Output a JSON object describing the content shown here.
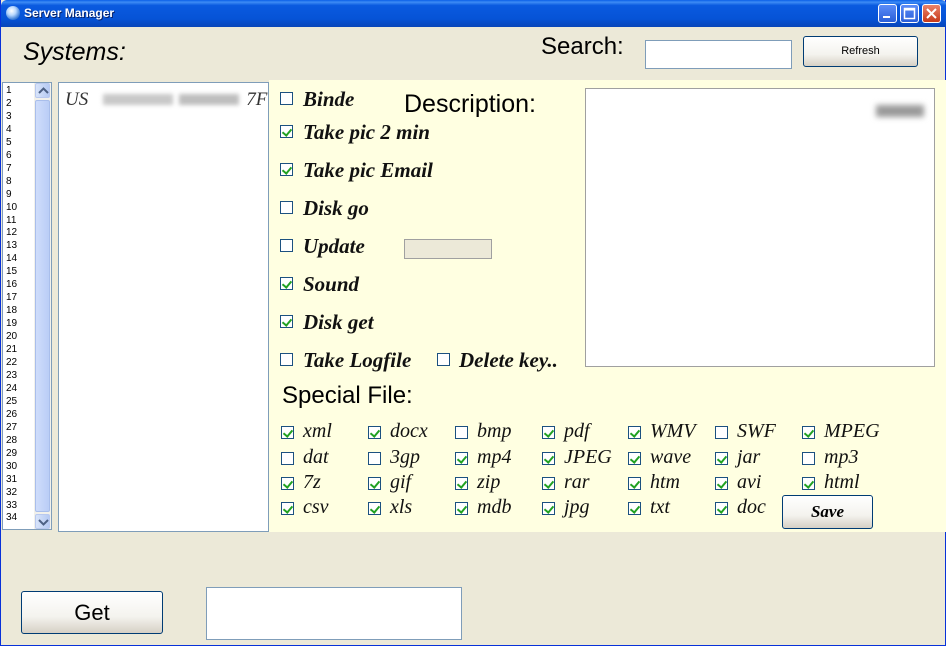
{
  "window": {
    "title": "Server Manager"
  },
  "header": {
    "systems_label": "Systems:",
    "search_label": "Search:",
    "search_value": "",
    "refresh_label": "Refresh"
  },
  "line_numbers": "1\n2\n3\n4\n5\n6\n7\n8\n9\n10\n11\n12\n13\n14\n15\n16\n17\n18\n19\n20\n21\n22\n23\n24\n25\n26\n27\n28\n29\n30\n31\n32\n33\n34",
  "systems": {
    "entry_prefix": "US",
    "entry_suffix": "7F"
  },
  "options": [
    {
      "label": "Binde",
      "checked": false
    },
    {
      "label": "Take pic 2 min",
      "checked": true
    },
    {
      "label": "Take pic Email",
      "checked": true
    },
    {
      "label": "Disk go",
      "checked": false
    },
    {
      "label": "Update",
      "checked": false
    },
    {
      "label": "Sound",
      "checked": true
    },
    {
      "label": "Disk get",
      "checked": true
    },
    {
      "label": "Take Logfile",
      "checked": false
    },
    {
      "label": "Delete key..",
      "checked": false
    }
  ],
  "description": {
    "label": "Description:"
  },
  "special_file": {
    "label": "Special File:",
    "files": [
      {
        "label": "xml",
        "checked": true
      },
      {
        "label": "docx",
        "checked": true
      },
      {
        "label": "bmp",
        "checked": false
      },
      {
        "label": "pdf",
        "checked": true
      },
      {
        "label": "WMV",
        "checked": true
      },
      {
        "label": "SWF",
        "checked": false
      },
      {
        "label": "MPEG",
        "checked": true
      },
      {
        "label": "dat",
        "checked": false
      },
      {
        "label": "3gp",
        "checked": false
      },
      {
        "label": "mp4",
        "checked": true
      },
      {
        "label": "JPEG",
        "checked": true
      },
      {
        "label": "wave",
        "checked": true
      },
      {
        "label": "jar",
        "checked": true
      },
      {
        "label": "mp3",
        "checked": false
      },
      {
        "label": "7z",
        "checked": true
      },
      {
        "label": "gif",
        "checked": true
      },
      {
        "label": "zip",
        "checked": true
      },
      {
        "label": "rar",
        "checked": true
      },
      {
        "label": "htm",
        "checked": true
      },
      {
        "label": "avi",
        "checked": true
      },
      {
        "label": "html",
        "checked": true
      },
      {
        "label": "csv",
        "checked": true
      },
      {
        "label": "xls",
        "checked": true
      },
      {
        "label": "mdb",
        "checked": true
      },
      {
        "label": "jpg",
        "checked": true
      },
      {
        "label": "txt",
        "checked": true
      },
      {
        "label": "doc",
        "checked": true
      }
    ],
    "save_label": "Save"
  },
  "footer": {
    "get_label": "Get",
    "output_value": ""
  }
}
